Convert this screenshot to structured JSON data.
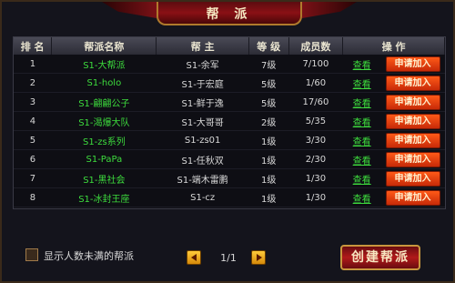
{
  "title": "帮 派",
  "columns": {
    "rank": "排 名",
    "name": "帮派名称",
    "boss": "帮 主",
    "level": "等 级",
    "members": "成员数",
    "actions": "操 作"
  },
  "rows": [
    {
      "rank": "1",
      "name": "S1-大帮派",
      "boss": "S1-余军",
      "level": "7级",
      "members": "7/100",
      "view": "查看",
      "apply": "申请加入"
    },
    {
      "rank": "2",
      "name": "S1-holo",
      "boss": "S1-于宏庭",
      "level": "5级",
      "members": "1/60",
      "view": "查看",
      "apply": "申请加入"
    },
    {
      "rank": "3",
      "name": "S1-翩翩公子",
      "boss": "S1-鲜于逸",
      "level": "5级",
      "members": "17/60",
      "view": "查看",
      "apply": "申请加入"
    },
    {
      "rank": "4",
      "name": "S1-渴爆大队",
      "boss": "S1-大哥哥",
      "level": "2级",
      "members": "5/35",
      "view": "查看",
      "apply": "申请加入"
    },
    {
      "rank": "5",
      "name": "S1-zs系列",
      "boss": "S1-zs01",
      "level": "1级",
      "members": "3/30",
      "view": "查看",
      "apply": "申请加入"
    },
    {
      "rank": "6",
      "name": "S1-PaPa",
      "boss": "S1-任秋双",
      "level": "1级",
      "members": "2/30",
      "view": "查看",
      "apply": "申请加入"
    },
    {
      "rank": "7",
      "name": "S1-黑社会",
      "boss": "S1-端木雷鹏",
      "level": "1级",
      "members": "1/30",
      "view": "查看",
      "apply": "申请加入"
    },
    {
      "rank": "8",
      "name": "S1-冰封王座",
      "boss": "S1-cz",
      "level": "1级",
      "members": "1/30",
      "view": "查看",
      "apply": "申请加入"
    }
  ],
  "footer": {
    "checkbox_label": "显示人数未满的帮派",
    "page": "1/1",
    "create_button": "创建帮派"
  },
  "colors": {
    "title_red": "#8a1015",
    "name_green": "#3ddb3d",
    "apply_orange": "#e2410c",
    "gold_border": "#c8963e"
  }
}
